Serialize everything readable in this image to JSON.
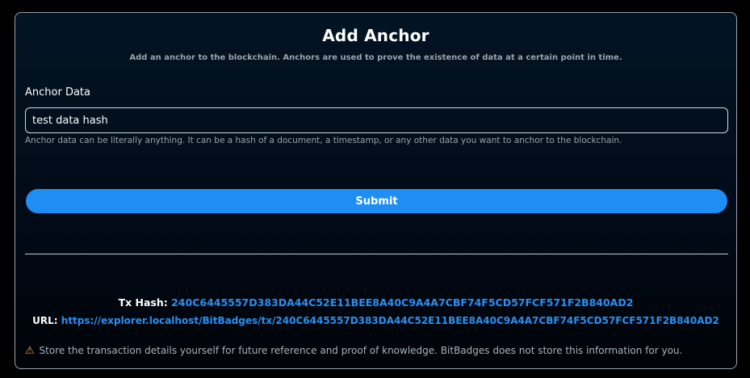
{
  "form": {
    "title": "Add Anchor",
    "subtitle": "Add an anchor to the blockchain. Anchors are used to prove the existence of data at a certain point in time.",
    "anchor_label": "Anchor Data",
    "anchor_value": "test data hash",
    "anchor_help": "Anchor data can be literally anything. It can be a hash of a document, a timestamp, or any other data you want to anchor to the blockchain.",
    "submit_label": "Submit"
  },
  "result": {
    "tx_hash_label": "Tx Hash:",
    "tx_hash": "240C6445557D383DA44C52E11BEE8A40C9A4A7CBF74F5CD57FCF571F2B840AD2",
    "url_label": "URL:",
    "url": "https://explorer.localhost/BitBadges/tx/240C6445557D383DA44C52E11BEE8A40C9A4A7CBF74F5CD57FCF571F2B840AD2",
    "warning_icon": "warning-icon",
    "warning": "Store the transaction details yourself for future reference and proof of knowledge. BitBadges does not store this information for you."
  },
  "colors": {
    "accent": "#1e8ef5",
    "link": "#2a8ff2",
    "warning": "#f0a21b"
  }
}
